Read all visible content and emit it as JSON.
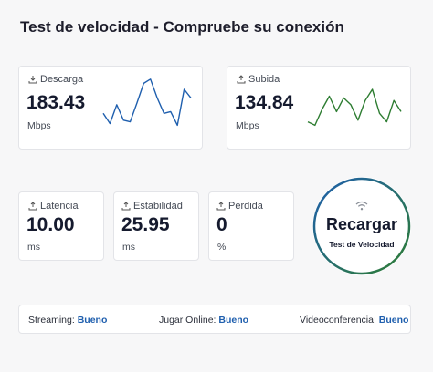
{
  "page": {
    "title": "Test de velocidad - Compruebe su conexión"
  },
  "download": {
    "label": "Descarga",
    "value": "183.43",
    "unit": "Mbps",
    "color": "#1f5fae",
    "samples": [
      20,
      8,
      30,
      12,
      10,
      32,
      55,
      60,
      38,
      20,
      22,
      6,
      48,
      38
    ]
  },
  "upload": {
    "label": "Subida",
    "value": "134.84",
    "unit": "Mbps",
    "color": "#2e7d32",
    "samples": [
      10,
      6,
      25,
      40,
      22,
      38,
      30,
      12,
      35,
      48,
      20,
      10,
      35,
      22
    ]
  },
  "latency": {
    "label": "Latencia",
    "value": "10.00",
    "unit": "ms"
  },
  "stability": {
    "label": "Estabilidad",
    "value": "25.95",
    "unit": "ms"
  },
  "loss": {
    "label": "Perdida",
    "value": "0",
    "unit": "%"
  },
  "reload": {
    "label": "Recargar",
    "sublabel": "Test de Velocidad",
    "ring_from": "#1f5fae",
    "ring_to": "#2e7d32"
  },
  "ratings": [
    {
      "label": "Streaming:",
      "value": "Bueno"
    },
    {
      "label": "Jugar Online:",
      "value": "Bueno"
    },
    {
      "label": "Videoconferencia:",
      "value": "Bueno"
    }
  ],
  "icons": {
    "download": "download-icon",
    "upload": "upload-icon",
    "wifi": "wifi-icon"
  }
}
